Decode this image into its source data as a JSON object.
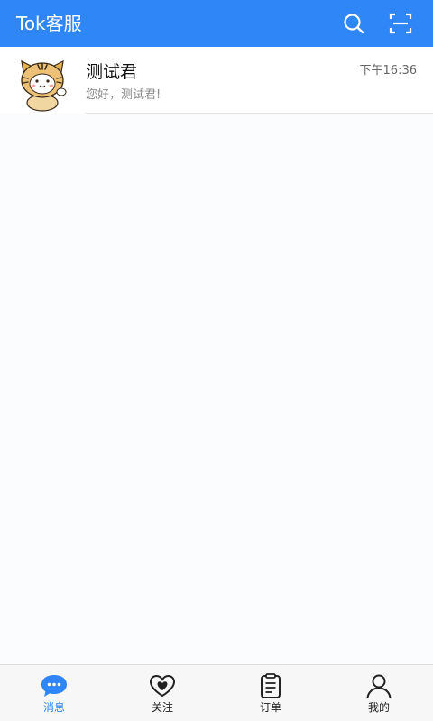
{
  "header": {
    "title": "Tok客服",
    "search_icon": "search-icon",
    "scan_icon": "scan-icon"
  },
  "conversations": [
    {
      "name": "测试君",
      "last_message": "您好，测试君!",
      "time": "下午16:36",
      "avatar_icon": "tiger-avatar"
    }
  ],
  "tabs": [
    {
      "label": "消息",
      "icon": "chat-bubble-icon",
      "active": true
    },
    {
      "label": "关注",
      "icon": "heart-icon",
      "active": false
    },
    {
      "label": "订单",
      "icon": "clipboard-icon",
      "active": false
    },
    {
      "label": "我的",
      "icon": "person-icon",
      "active": false
    }
  ],
  "colors": {
    "primary": "#2f86f6",
    "background": "#fbfcfd",
    "tabbar": "#f7f7f7"
  }
}
